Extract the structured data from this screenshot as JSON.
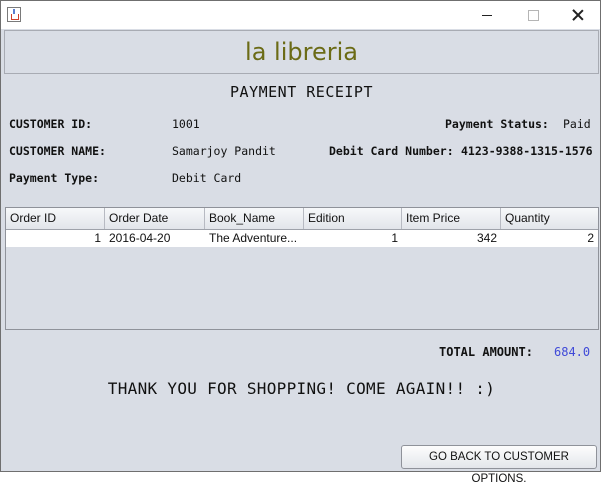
{
  "window": {
    "app_icon": "java-cup-icon",
    "controls": [
      "minimize-icon",
      "maximize-icon",
      "close-icon"
    ]
  },
  "header": {
    "brand": "la libreria",
    "brand_color": "#6b6b16"
  },
  "receipt": {
    "title": "PAYMENT RECEIPT",
    "customer_id_label": "CUSTOMER ID:",
    "customer_id": "1001",
    "customer_name_label": "CUSTOMER NAME:",
    "customer_name": "Samarjoy Pandit",
    "payment_type_label": "Payment Type:",
    "payment_type": "Debit Card",
    "payment_status_label": "Payment Status:",
    "payment_status": "Paid",
    "card_number_label": "Debit Card Number:",
    "card_number": "4123-9388-1315-1576"
  },
  "table": {
    "columns": [
      "Order ID",
      "Order Date",
      "Book_Name",
      "Edition",
      "Item Price",
      "Quantity"
    ],
    "rows": [
      {
        "order_id": "1",
        "order_date": "2016-04-20",
        "book_name": "The Adventure...",
        "edition": "1",
        "item_price": "342",
        "quantity": "2"
      }
    ]
  },
  "total": {
    "label": "TOTAL AMOUNT:",
    "value": "684.0",
    "value_color": "#3f49d8"
  },
  "thanks": "THANK YOU FOR SHOPPING! COME AGAIN!! :)",
  "buttons": {
    "back": "GO BACK TO CUSTOMER OPTIONS."
  }
}
